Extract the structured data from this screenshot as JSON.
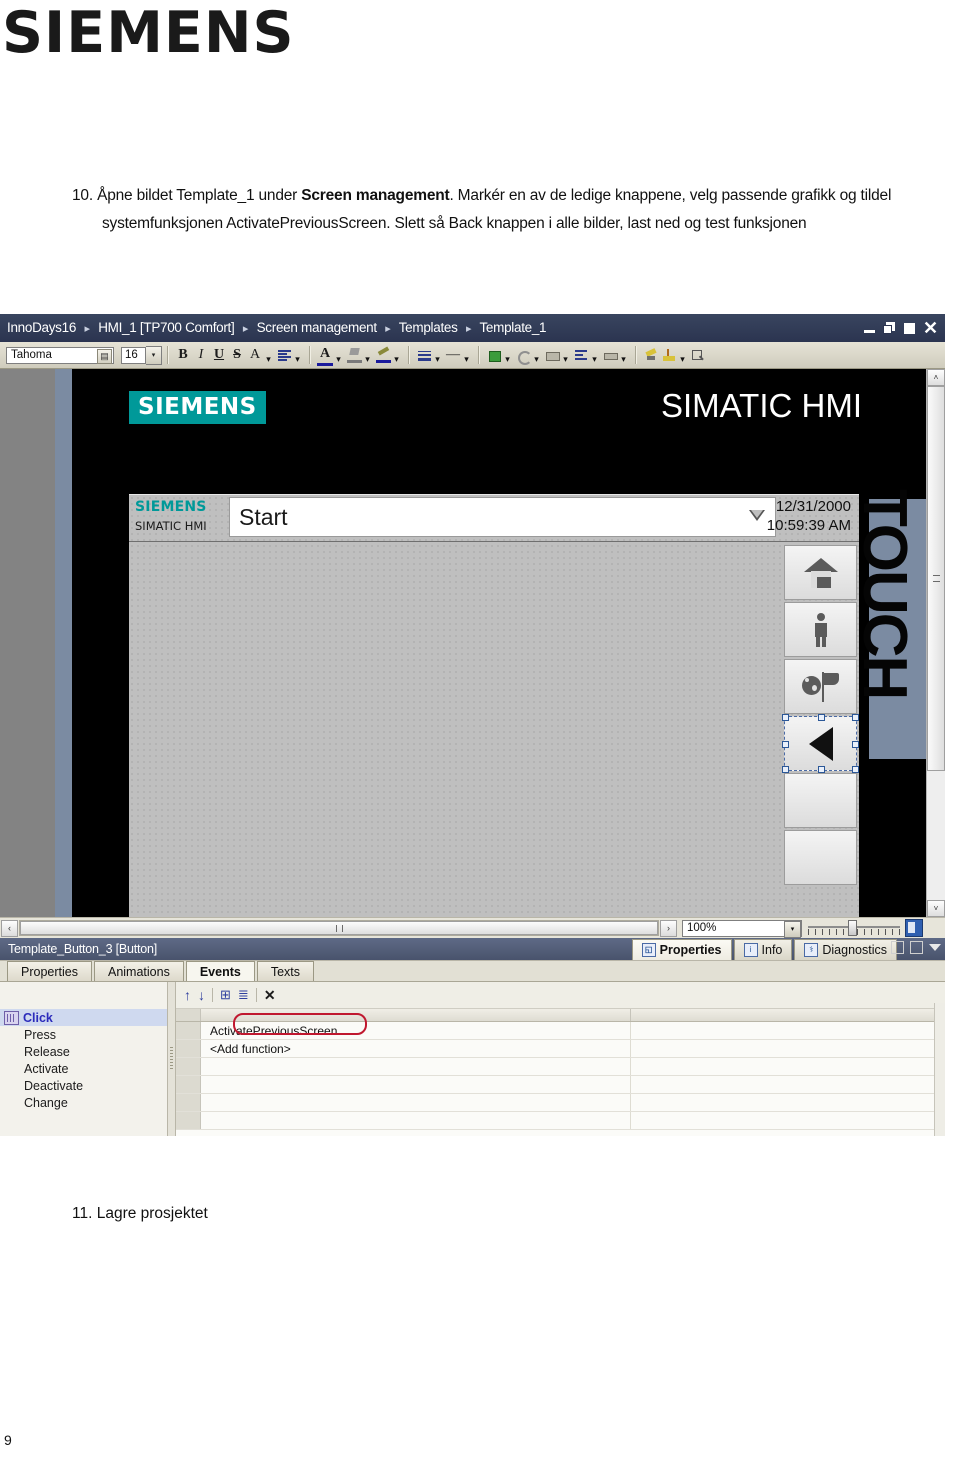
{
  "page": {
    "brand": "SIEMENS",
    "page_number": "9"
  },
  "instruction": {
    "number": "10.",
    "part1": "Åpne bildet Template_1 under ",
    "bold": "Screen management",
    "part2": ". Markér en av de ledige knappene, velg passende grafikk og tildel systemfunksjonen ActivatePreviousScreen. Slett så Back knappen i alle bilder, last ned og test funksjonen"
  },
  "step11": "11. Lagre prosjektet",
  "tia": {
    "breadcrumb": [
      "InnoDays16",
      "HMI_1 [TP700 Comfort]",
      "Screen management",
      "Templates",
      "Template_1"
    ],
    "breadcrumb_separator": "▸",
    "window_controls": {
      "minimize": "minimize-icon",
      "restore": "restore-icon",
      "maximize": "maximize-icon",
      "close": "✕"
    },
    "toolbar": {
      "font_name": "Tahoma",
      "font_size": "16",
      "bold": "B",
      "italic": "I",
      "underline": "U",
      "strikethrough": "S",
      "font_effect": "A",
      "align": "≡",
      "font_color": "A",
      "fill_color": "fill-color-icon",
      "pen_color": "pen-color-icon",
      "line_weight": "≡",
      "line_style": "—",
      "fill_style": "fill-style-icon",
      "rotate": "rotate-icon",
      "align_objects": "align-objects-icon",
      "distribute": "distribute-icon",
      "resize": "resize-icon",
      "format_painter": "format-painter-icon",
      "order": "order-icon",
      "zoom_tool": "zoom-tool-icon",
      "dropdown_caret": "▾"
    },
    "hmi_screen": {
      "logo": "SIEMENS",
      "title": "SIMATIC HMI",
      "side_text": "TOUCH",
      "template": {
        "siemens": "SIEMENS",
        "simatic": "SIMATIC HMI",
        "start_value": "Start",
        "date": "12/31/2000",
        "time": "10:59:39 AM",
        "buttons": [
          {
            "name": "home-button",
            "icon": "home-icon",
            "selected": false
          },
          {
            "name": "person-button",
            "icon": "person-icon",
            "selected": false
          },
          {
            "name": "language-button",
            "icon": "globe-flag-icon",
            "selected": false
          },
          {
            "name": "back-button",
            "icon": "back-triangle-icon",
            "selected": true
          },
          {
            "name": "empty-button-1",
            "icon": "",
            "selected": false
          },
          {
            "name": "empty-button-2",
            "icon": "",
            "selected": false
          }
        ]
      }
    },
    "statusbar": {
      "zoom_value": "100%",
      "scroll_left": "‹",
      "scroll_right": "›",
      "scroll_up": "˄",
      "scroll_down": "˅"
    },
    "object_bar": {
      "selected_object": "Template_Button_3 [Button]",
      "tabs": [
        {
          "label": "Properties",
          "icon": "properties-icon",
          "active": true
        },
        {
          "label": "Info",
          "icon": "info-icon",
          "active": false
        },
        {
          "label": "Diagnostics",
          "icon": "diagnostics-icon",
          "active": false
        }
      ]
    },
    "properties_panel": {
      "tabs": [
        {
          "label": "Properties",
          "active": false
        },
        {
          "label": "Animations",
          "active": false
        },
        {
          "label": "Events",
          "active": true
        },
        {
          "label": "Texts",
          "active": false
        }
      ],
      "toolbar": [
        {
          "name": "move-up-button",
          "glyph": "↑"
        },
        {
          "name": "move-down-button",
          "glyph": "↓"
        },
        {
          "name": "add-function-list-button",
          "glyph": "⊞"
        },
        {
          "name": "edit-list-button",
          "glyph": "≣"
        },
        {
          "name": "delete-button",
          "glyph": "✕"
        }
      ],
      "events": [
        {
          "label": "Click",
          "active": true
        },
        {
          "label": "Press",
          "active": false
        },
        {
          "label": "Release",
          "active": false
        },
        {
          "label": "Activate",
          "active": false
        },
        {
          "label": "Deactivate",
          "active": false
        },
        {
          "label": "Change",
          "active": false
        }
      ],
      "function_rows": [
        {
          "text": "ActivatePreviousScreen",
          "highlighted": true
        },
        {
          "text": "<Add function>",
          "highlighted": false
        },
        {
          "text": "",
          "highlighted": false
        },
        {
          "text": "",
          "highlighted": false
        },
        {
          "text": "",
          "highlighted": false
        },
        {
          "text": "",
          "highlighted": false
        }
      ]
    }
  },
  "colors": {
    "siemens_teal": "#009999",
    "titlebar": "#2b3450",
    "annotation_red": "#c0182f",
    "touch_band": "#7b8ba2"
  }
}
